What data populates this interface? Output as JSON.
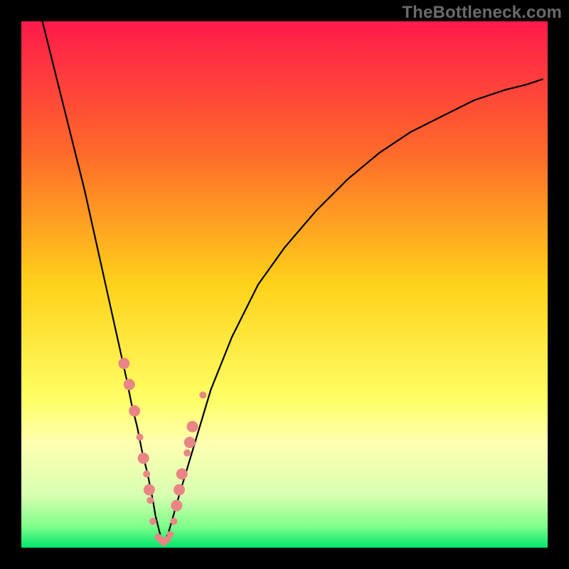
{
  "watermark": "TheBottleneck.com",
  "chart_data": {
    "type": "line",
    "title": "",
    "xlabel": "",
    "ylabel": "",
    "xlim": [
      0,
      100
    ],
    "ylim": [
      0,
      100
    ],
    "grid": false,
    "legend": false,
    "gradient_stops": [
      {
        "offset": 0.0,
        "color": "#ff1a4b"
      },
      {
        "offset": 0.25,
        "color": "#ff6a2a"
      },
      {
        "offset": 0.5,
        "color": "#ffd21a"
      },
      {
        "offset": 0.72,
        "color": "#ffff66"
      },
      {
        "offset": 0.8,
        "color": "#ffffb0"
      },
      {
        "offset": 0.9,
        "color": "#d8ffb0"
      },
      {
        "offset": 0.96,
        "color": "#7fff8a"
      },
      {
        "offset": 1.0,
        "color": "#00e56a"
      }
    ],
    "series": [
      {
        "name": "curve-left",
        "color": "#000000",
        "width": 2.2,
        "x": [
          4,
          6,
          8,
          10,
          12,
          14,
          16,
          18,
          20,
          21,
          22,
          23,
          24,
          25,
          25.5,
          26,
          26.5,
          27
        ],
        "y": [
          100,
          92,
          84,
          76,
          68,
          59,
          50,
          41,
          32,
          27,
          23,
          18,
          14,
          9,
          6,
          4,
          2,
          0.5
        ]
      },
      {
        "name": "curve-right",
        "color": "#000000",
        "width": 2.2,
        "x": [
          27,
          28,
          30,
          33,
          36,
          40,
          45,
          50,
          56,
          62,
          68,
          74,
          80,
          86,
          92,
          96,
          99
        ],
        "y": [
          0.5,
          3,
          10,
          20,
          30,
          40,
          50,
          57,
          64,
          70,
          75,
          79,
          82,
          85,
          87,
          88,
          89
        ]
      }
    ],
    "scatter": {
      "name": "points",
      "color": "#e98685",
      "radius_small": 5,
      "radius_large": 8,
      "points": [
        {
          "x": 19.5,
          "y": 35,
          "r": "large"
        },
        {
          "x": 20.5,
          "y": 31,
          "r": "large"
        },
        {
          "x": 21.5,
          "y": 26,
          "r": "large"
        },
        {
          "x": 22.5,
          "y": 21,
          "r": "small"
        },
        {
          "x": 23.2,
          "y": 17,
          "r": "large"
        },
        {
          "x": 23.8,
          "y": 14,
          "r": "small"
        },
        {
          "x": 24.3,
          "y": 11,
          "r": "large"
        },
        {
          "x": 24.5,
          "y": 9,
          "r": "small"
        },
        {
          "x": 25.0,
          "y": 5,
          "r": "small"
        },
        {
          "x": 26.0,
          "y": 2,
          "r": "small"
        },
        {
          "x": 26.5,
          "y": 1.5,
          "r": "small"
        },
        {
          "x": 27.0,
          "y": 1,
          "r": "small"
        },
        {
          "x": 27.7,
          "y": 1.5,
          "r": "small"
        },
        {
          "x": 28.3,
          "y": 2.5,
          "r": "small"
        },
        {
          "x": 29.0,
          "y": 5,
          "r": "small"
        },
        {
          "x": 29.5,
          "y": 8,
          "r": "large"
        },
        {
          "x": 30.0,
          "y": 11,
          "r": "large"
        },
        {
          "x": 30.5,
          "y": 14,
          "r": "large"
        },
        {
          "x": 31.5,
          "y": 18,
          "r": "small"
        },
        {
          "x": 32.0,
          "y": 20,
          "r": "large"
        },
        {
          "x": 32.5,
          "y": 23,
          "r": "large"
        },
        {
          "x": 34.5,
          "y": 29,
          "r": "small"
        }
      ]
    }
  }
}
